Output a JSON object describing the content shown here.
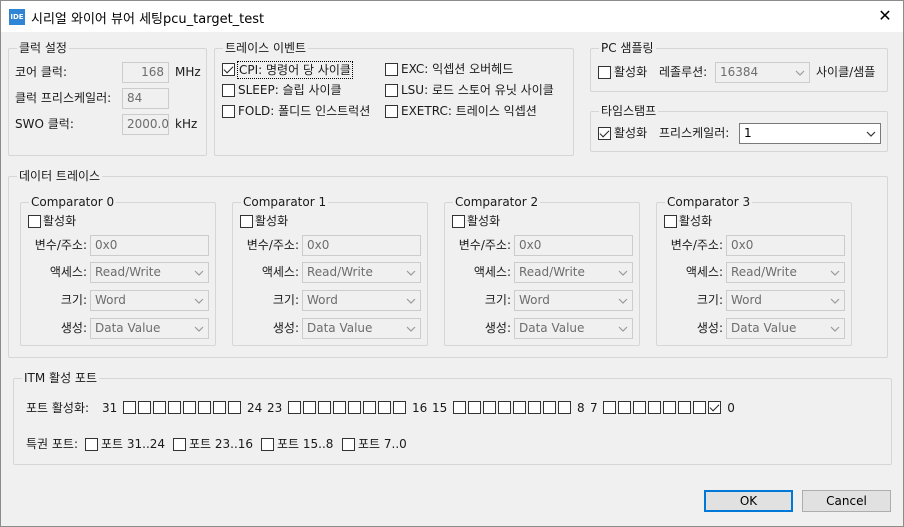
{
  "window": {
    "icon_text": "IDE",
    "title": "시리얼 와이어 뷰어 세팅pcu_target_test"
  },
  "clock": {
    "legend": "클럭 설정",
    "core_label": "코어 클럭:",
    "core_value": "168",
    "core_unit": "MHz",
    "prescaler_label": "클럭 프리스케일러:",
    "prescaler_value": "84",
    "swo_label": "SWO 클럭:",
    "swo_value": "2000.0",
    "swo_unit": "kHz"
  },
  "trace_events": {
    "legend": "트레이스 이벤트",
    "items": [
      {
        "label": "CPI: 명령어 당 사이클",
        "checked": true
      },
      {
        "label": "EXC: 익셉션 오버헤드",
        "checked": false
      },
      {
        "label": "SLEEP: 슬립 사이클",
        "checked": false
      },
      {
        "label": "LSU: 로드 스토어 유닛 사이클",
        "checked": false
      },
      {
        "label": "FOLD: 폴디드 인스트럭션",
        "checked": false
      },
      {
        "label": "EXETRC: 트레이스 익셉션",
        "checked": false
      }
    ]
  },
  "pc_sampling": {
    "legend": "PC 샘플링",
    "enable_label": "활성화",
    "enabled": false,
    "resolution_label": "레졸루션:",
    "resolution_value": "16384",
    "unit": "사이클/샘플"
  },
  "timestamp": {
    "legend": "타임스탬프",
    "enable_label": "활성화",
    "enabled": true,
    "prescaler_label": "프리스케일러:",
    "prescaler_value": "1"
  },
  "data_trace": {
    "legend": "데이터 트레이스",
    "comparators": [
      {
        "title": "Comparator 0",
        "enable_label": "활성화",
        "var_label": "변수/주소:",
        "var_value": "0x0",
        "access_label": "액세스:",
        "access_value": "Read/Write",
        "size_label": "크기:",
        "size_value": "Word",
        "gen_label": "생성:",
        "gen_value": "Data Value"
      },
      {
        "title": "Comparator 1",
        "enable_label": "활성화",
        "var_label": "변수/주소:",
        "var_value": "0x0",
        "access_label": "액세스:",
        "access_value": "Read/Write",
        "size_label": "크기:",
        "size_value": "Word",
        "gen_label": "생성:",
        "gen_value": "Data Value"
      },
      {
        "title": "Comparator 2",
        "enable_label": "활성화",
        "var_label": "변수/주소:",
        "var_value": "0x0",
        "access_label": "액세스:",
        "access_value": "Read/Write",
        "size_label": "크기:",
        "size_value": "Word",
        "gen_label": "생성:",
        "gen_value": "Data Value"
      },
      {
        "title": "Comparator 3",
        "enable_label": "활성화",
        "var_label": "변수/주소:",
        "var_value": "0x0",
        "access_label": "액세스:",
        "access_value": "Read/Write",
        "size_label": "크기:",
        "size_value": "Word",
        "gen_label": "생성:",
        "gen_value": "Data Value"
      }
    ]
  },
  "itm": {
    "legend": "ITM 활성 포트",
    "port_enable_label": "포트 활성화:",
    "groups": [
      {
        "start": "31",
        "end": "24",
        "checked_last": false
      },
      {
        "start": "23",
        "end": "16",
        "checked_last": false
      },
      {
        "start": "15",
        "end": "8",
        "checked_last": false
      },
      {
        "start": "7",
        "end": "0",
        "checked_last": true
      }
    ],
    "privileged_label": "특권 포트:",
    "privileged": [
      {
        "label": "포트 31..24",
        "checked": false
      },
      {
        "label": "포트 23..16",
        "checked": false
      },
      {
        "label": "포트 15..8",
        "checked": false
      },
      {
        "label": "포트 7..0",
        "checked": false
      }
    ]
  },
  "buttons": {
    "ok": "OK",
    "cancel": "Cancel"
  }
}
